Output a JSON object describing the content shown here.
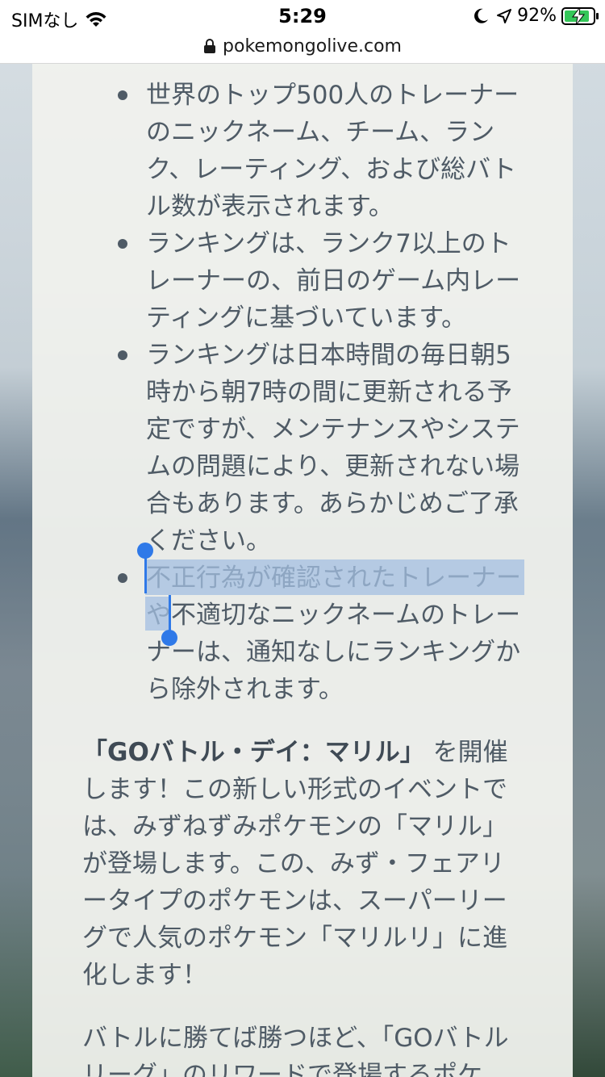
{
  "status_bar": {
    "carrier": "SIMなし",
    "time": "5:29",
    "battery_percent": "92%",
    "icons": [
      "wifi-icon",
      "moon-icon",
      "location-icon",
      "battery-charging-icon"
    ]
  },
  "url_bar": {
    "domain": "pokemongolive.com",
    "icon": "lock-icon"
  },
  "article": {
    "bullets": [
      "世界のトップ500人のトレーナーのニックネーム、チーム、ランク、レーティング、および総バトル数が表示されます。",
      "ランキングは、ランク7以上のトレーナーの、前日のゲーム内レーティングに基づいています。",
      "ランキングは日本時間の毎日朝5時から朝7時の間に更新される予定ですが、メンテナンスやシステムの問題により、更新されない場合もあります。あらかじめご了承ください。",
      "不正行為が確認されたトレーナーや不適切なニックネームのトレーナーは、通知なしにランキングから除外されます。"
    ],
    "paragraph1_bold": "「GOバトル・デイ：マリル」",
    "paragraph1_rest": "を開催します！この新しい形式のイベントでは、みずねずみポケモンの「マリル」が登場します。この、みず・フェアリータイプのポケモンは、スーパーリーグで人気のポケモン「マリルリ」に進化します！",
    "paragraph2": "バトルに勝てば勝つほど、「GOバトルリーグ」のリワードで登場するポケ"
  },
  "colors": {
    "text": "#4f5b66",
    "selection": "#a3bfe2",
    "caret": "#2f79e8",
    "battery_fill": "#34c759"
  }
}
